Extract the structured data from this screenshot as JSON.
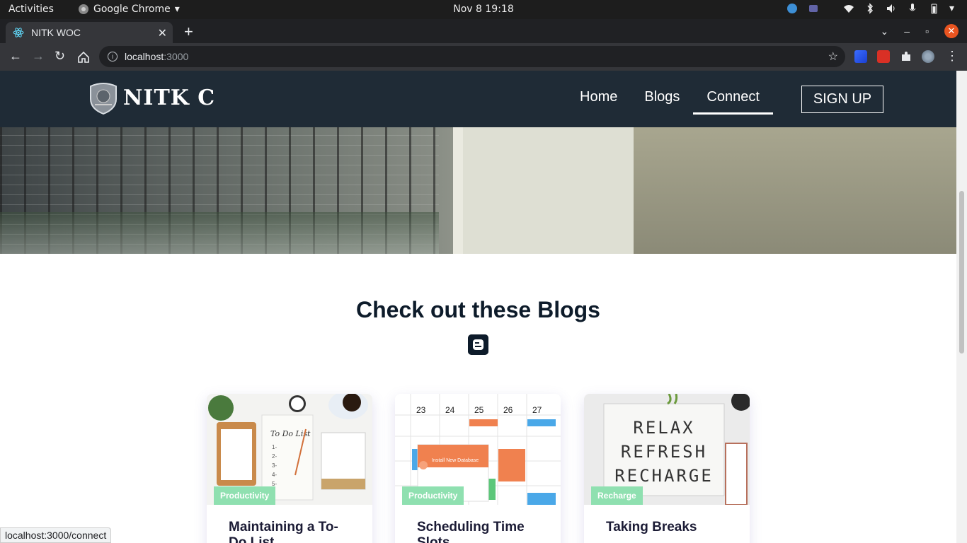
{
  "system": {
    "activities": "Activities",
    "app_name": "Google Chrome",
    "clock": "Nov 8  19:18"
  },
  "browser": {
    "tab_title": "NITK WOC",
    "url_host": "localhost",
    "url_port": ":3000",
    "status_url": "localhost:3000/connect"
  },
  "site": {
    "brand": "NITK C",
    "nav": [
      {
        "label": "Home",
        "active": false
      },
      {
        "label": "Blogs",
        "active": false
      },
      {
        "label": "Connect",
        "active": true
      }
    ],
    "signup_label": "SIGN UP",
    "section_title": "Check out these Blogs"
  },
  "cards": [
    {
      "tag": "Productivity",
      "title": "Maintaining a To-Do List"
    },
    {
      "tag": "Productivity",
      "title": "Scheduling Time Slots"
    },
    {
      "tag": "Recharge",
      "title": "Taking Breaks"
    }
  ],
  "thumb_text": {
    "todo_heading": "To Do List",
    "todo_items": [
      "1-",
      "2-",
      "3-",
      "4-",
      "5-"
    ],
    "cal_days": [
      "23",
      "24",
      "25",
      "26",
      "27"
    ],
    "cal_popup": "Install New Database",
    "lightbox": [
      "RELAX",
      "REFRESH",
      "RECHARGE"
    ]
  },
  "colors": {
    "header_bg": "#1f2b36",
    "title_color": "#0d1b2a",
    "tag_bg": "#8fe0b0",
    "chrome_close": "#e95420"
  }
}
